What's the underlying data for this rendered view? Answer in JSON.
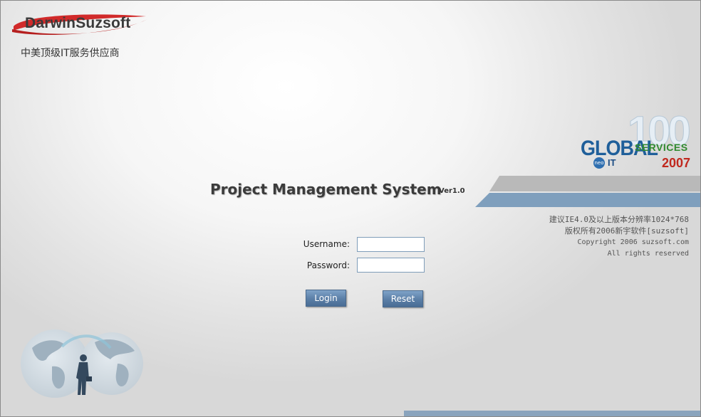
{
  "brand": {
    "logo_text": "DarwinSuzsoft",
    "tagline": "中美顶级IT服务供应商"
  },
  "badge": {
    "global": "GLOBAL",
    "number": "100",
    "services": "SERVICES",
    "year": "2007",
    "neo": "neo",
    "it": "IT"
  },
  "header": {
    "title": "Project Management System",
    "version": "Ver1.0"
  },
  "info": {
    "browser_note": "建议IE4.0及以上版本分辨率1024*768",
    "rights_cn": "版权所有2006新宇软件[suzsoft]",
    "copyright": "Copyright 2006 suzsoft.com",
    "rights_en": "All rights reserved"
  },
  "form": {
    "username_label": "Username:",
    "username_value": "",
    "password_label": "Password:",
    "password_value": "",
    "login_label": "Login",
    "reset_label": "Reset"
  },
  "colors": {
    "stripe_blue": "#7f9fbd",
    "stripe_grey": "#b9b9b9",
    "button_blue": "#5a7ea6",
    "logo_red": "#d12a2a"
  }
}
